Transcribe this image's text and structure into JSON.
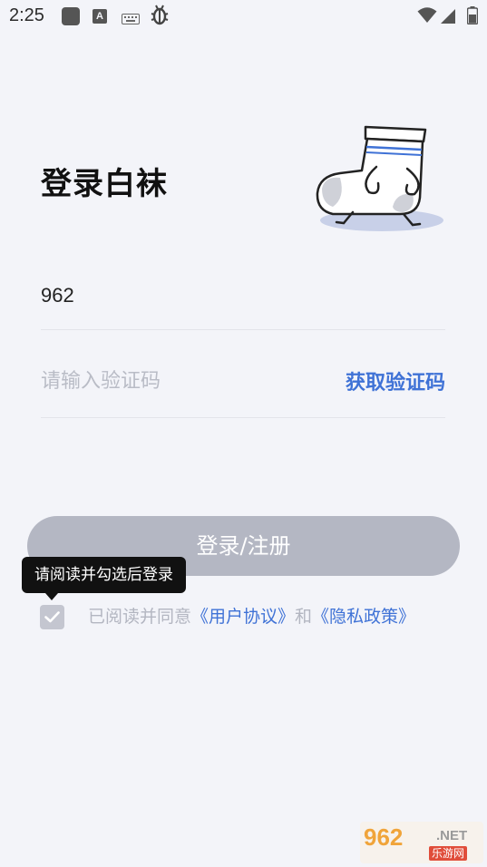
{
  "status_bar": {
    "time": "2:25",
    "icons": [
      "square-app-icon",
      "a-letter-icon",
      "keyboard-icon",
      "bug-icon",
      "wifi-icon",
      "signal-icon",
      "battery-icon"
    ]
  },
  "login": {
    "title": "登录白袜",
    "phone_value": "962",
    "code_placeholder": "请输入验证码",
    "get_code_label": "获取验证码",
    "submit_label": "登录/注册",
    "tooltip_text": "请阅读并勾选后登录",
    "agreement": {
      "prefix": "已阅读并同意",
      "user_agreement": "《用户协议》",
      "conjunction": "和",
      "privacy_policy": "《隐私政策》"
    }
  },
  "watermark": {
    "logo_text": "962",
    "suffix": ".NET",
    "subtitle": "乐游网"
  },
  "colors": {
    "background": "#f3f4f9",
    "accent": "#3f72d6",
    "button_disabled": "#b4b7c3",
    "placeholder": "#b9bcc6"
  }
}
